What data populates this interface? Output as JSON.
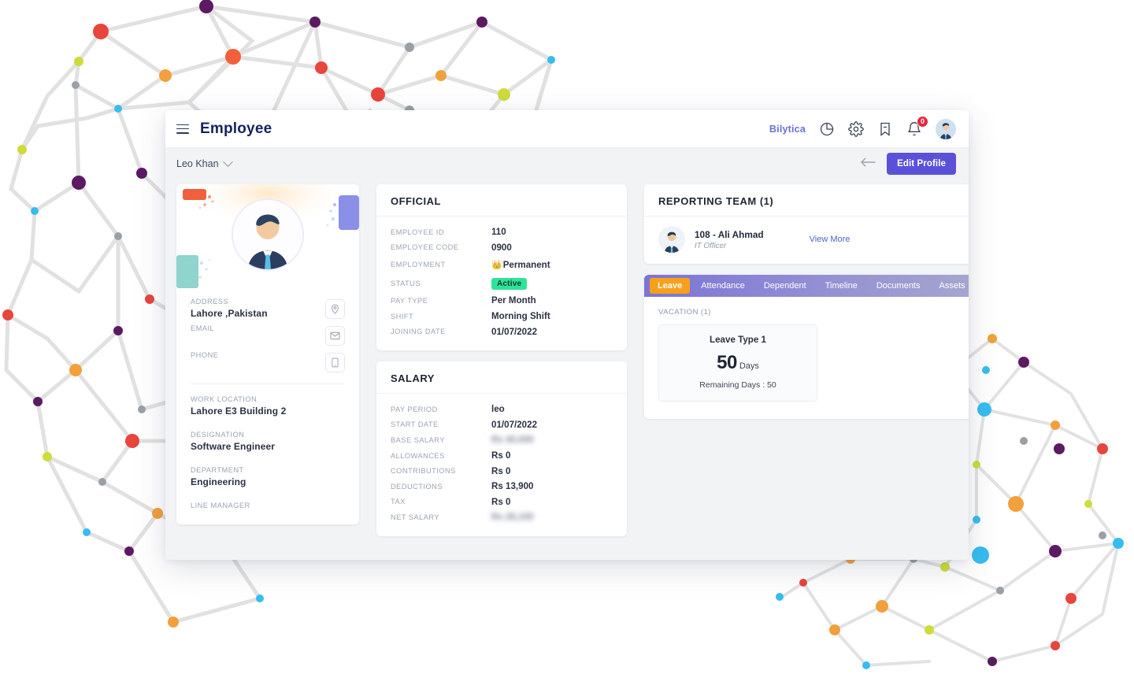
{
  "topbar": {
    "menu_icon": "hamburger-icon",
    "title": "Employee",
    "brand": "Bilytica",
    "icons": [
      "pie-chart-icon",
      "gear-icon",
      "bookmark-icon",
      "bell-icon"
    ],
    "notification_count": "0"
  },
  "subbar": {
    "employee_name": "Leo Khan",
    "back_icon": "arrow-left-icon",
    "edit_profile_label": "Edit Profile"
  },
  "profile": {
    "address_label": "ADDRESS",
    "address_value": "Lahore ,Pakistan",
    "email_label": "EMAIL",
    "email_value": "",
    "phone_label": "PHONE",
    "phone_value": "",
    "work_location_label": "WORK LOCATION",
    "work_location_value": "Lahore E3 Building 2",
    "designation_label": "DESIGNATION",
    "designation_value": "Software Engineer",
    "department_label": "DEPARTMENT",
    "department_value": "Engineering",
    "line_manager_label": "LINE MANAGER",
    "line_manager_value": ""
  },
  "official": {
    "title": "OFFICIAL",
    "rows": [
      {
        "label": "EMPLOYEE ID",
        "value": "110"
      },
      {
        "label": "EMPLOYEE CODE",
        "value": "0900"
      },
      {
        "label": "EMPLOYMENT",
        "value": "Permanent"
      },
      {
        "label": "STATUS",
        "value": "Active"
      },
      {
        "label": "PAY TYPE",
        "value": "Per Month"
      },
      {
        "label": "SHIFT",
        "value": "Morning Shift"
      },
      {
        "label": "JOINING DATE",
        "value": "01/07/2022"
      }
    ],
    "employment_badge_icon": "crown-icon",
    "status_badge_color": "#2ee39b"
  },
  "salary": {
    "title": "SALARY",
    "rows": [
      {
        "label": "PAY PERIOD",
        "value": "leo",
        "hidden": false
      },
      {
        "label": "START DATE",
        "value": "01/07/2022",
        "hidden": false
      },
      {
        "label": "BASE SALARY",
        "value": "Rs 40,000",
        "hidden": true
      },
      {
        "label": "ALLOWANCES",
        "value": "Rs 0",
        "hidden": false
      },
      {
        "label": "CONTRIBUTIONS",
        "value": "Rs 0",
        "hidden": false
      },
      {
        "label": "DEDUCTIONS",
        "value": "Rs 13,900",
        "hidden": false
      },
      {
        "label": "TAX",
        "value": "Rs 0",
        "hidden": false
      },
      {
        "label": "NET SALARY",
        "value": "Rs 26,100",
        "hidden": true
      }
    ]
  },
  "reporting_team": {
    "title": "REPORTING TEAM (1)",
    "member_name": "108 - Ali Ahmad",
    "member_role": "IT Officer",
    "view_more_label": "View More"
  },
  "tabs": {
    "items": [
      {
        "label": "Leave",
        "active": true
      },
      {
        "label": "Attendance",
        "active": false
      },
      {
        "label": "Dependent",
        "active": false
      },
      {
        "label": "Timeline",
        "active": false
      },
      {
        "label": "Documents",
        "active": false
      },
      {
        "label": "Assets",
        "active": false
      }
    ],
    "active_color": "#f8a01c"
  },
  "leave_panel": {
    "section_label": "VACATION (1)",
    "leave_type": "Leave Type 1",
    "days_value": "50",
    "days_unit": "Days",
    "remaining_text": "Remaining Days : 50"
  },
  "theme": {
    "primary": "#5b51d8",
    "accent_orange": "#f8a01c",
    "success_green": "#2ee39b",
    "danger_red": "#e8253f",
    "title_navy": "#14255c"
  }
}
